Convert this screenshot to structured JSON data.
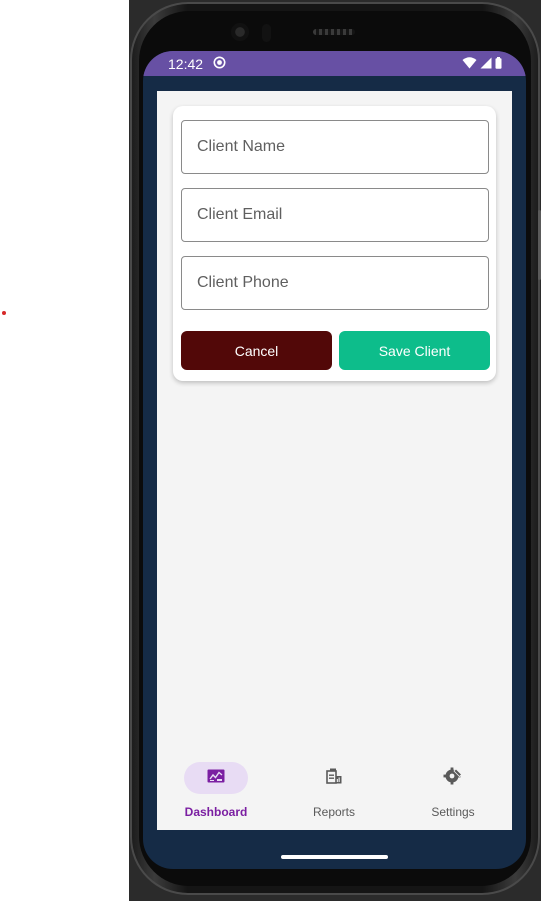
{
  "status_bar": {
    "time": "12:42",
    "color": "#6750a4"
  },
  "form": {
    "client_name_placeholder": "Client Name",
    "client_email_placeholder": "Client Email",
    "client_phone_placeholder": "Client Phone",
    "cancel_label": "Cancel",
    "save_label": "Save Client",
    "cancel_color": "#520808",
    "save_color": "#0dbd8b"
  },
  "bottom_nav": {
    "items": [
      {
        "label": "Dashboard",
        "icon": "dashboard-icon",
        "active": true
      },
      {
        "label": "Reports",
        "icon": "reports-icon",
        "active": false
      },
      {
        "label": "Settings",
        "icon": "settings-icon",
        "active": false
      }
    ],
    "active_color": "#7b1fa2"
  }
}
